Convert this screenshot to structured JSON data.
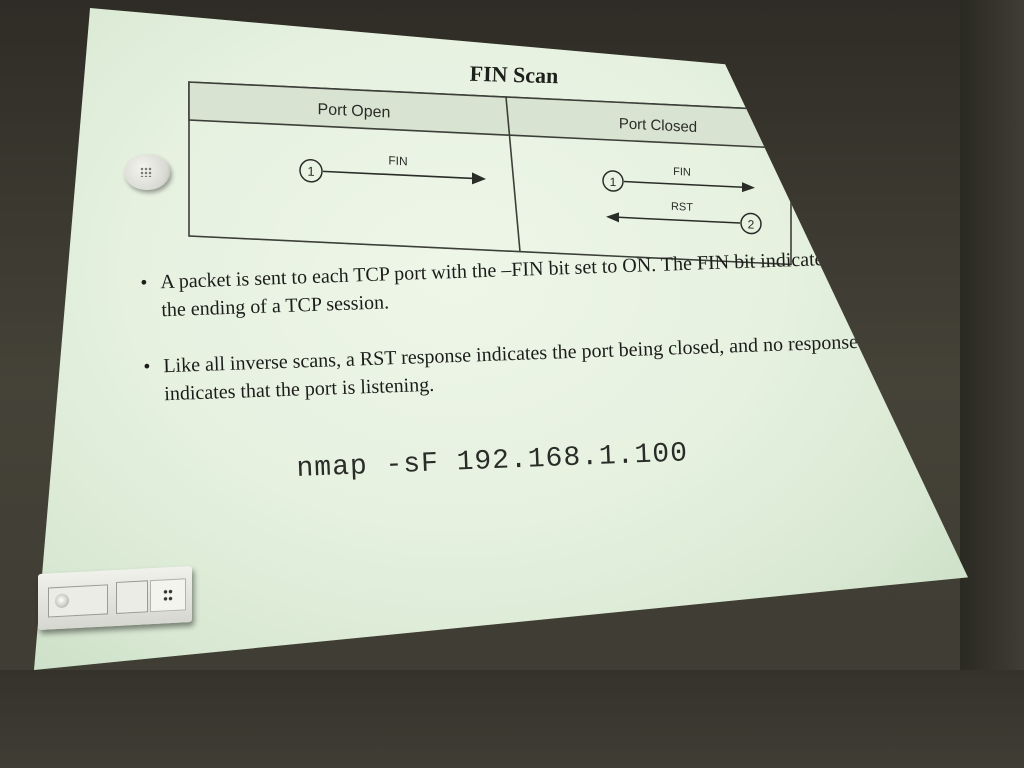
{
  "slide": {
    "title": "FIN Scan",
    "diagram": {
      "left_header": "Port Open",
      "right_header": "Port Closed",
      "left_step_number": "1",
      "left_label": "FIN",
      "right_step1_number": "1",
      "right_step1_label": "FIN",
      "right_step2_number": "2",
      "right_step2_label": "RST"
    },
    "bullets": [
      {
        "text": "A packet is sent to each TCP port with the –FIN bit set to ON. The FIN bit indicates the ending of a TCP session."
      },
      {
        "text": "Like all inverse scans, a RST response indicates the port being closed, and no response indicates that the port is listening."
      }
    ],
    "command": "nmap -sF 192.168.1.100"
  },
  "colors": {
    "screen": "#e6f1e0",
    "text": "#1c1d1a",
    "header_fill": "#d9e3d2",
    "wall": "#3f3d34"
  }
}
